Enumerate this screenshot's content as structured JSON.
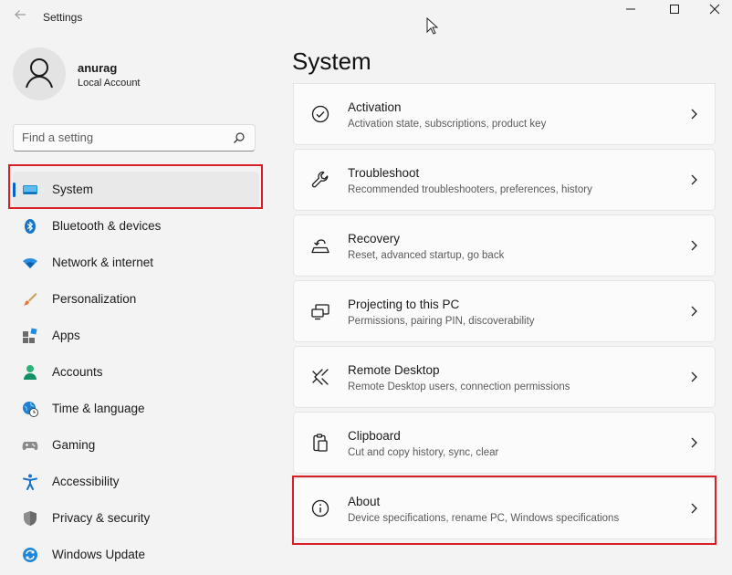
{
  "window": {
    "title": "Settings"
  },
  "user": {
    "name": "anurag",
    "account_type": "Local Account"
  },
  "search": {
    "placeholder": "Find a setting",
    "value": ""
  },
  "sidebar": {
    "items": [
      {
        "label": "System",
        "icon": "monitor-icon",
        "selected": true
      },
      {
        "label": "Bluetooth & devices",
        "icon": "bluetooth-icon"
      },
      {
        "label": "Network & internet",
        "icon": "wifi-icon"
      },
      {
        "label": "Personalization",
        "icon": "brush-icon"
      },
      {
        "label": "Apps",
        "icon": "apps-icon"
      },
      {
        "label": "Accounts",
        "icon": "person-icon"
      },
      {
        "label": "Time & language",
        "icon": "globe-clock-icon"
      },
      {
        "label": "Gaming",
        "icon": "gamepad-icon"
      },
      {
        "label": "Accessibility",
        "icon": "accessibility-icon"
      },
      {
        "label": "Privacy & security",
        "icon": "shield-icon"
      },
      {
        "label": "Windows Update",
        "icon": "update-icon"
      }
    ]
  },
  "main": {
    "title": "System",
    "cards": [
      {
        "title": "Activation",
        "description": "Activation state, subscriptions, product key",
        "icon": "check-circle-icon"
      },
      {
        "title": "Troubleshoot",
        "description": "Recommended troubleshooters, preferences, history",
        "icon": "wrench-icon"
      },
      {
        "title": "Recovery",
        "description": "Reset, advanced startup, go back",
        "icon": "recovery-icon"
      },
      {
        "title": "Projecting to this PC",
        "description": "Permissions, pairing PIN, discoverability",
        "icon": "projecting-icon"
      },
      {
        "title": "Remote Desktop",
        "description": "Remote Desktop users, connection permissions",
        "icon": "remote-desktop-icon"
      },
      {
        "title": "Clipboard",
        "description": "Cut and copy history, sync, clear",
        "icon": "clipboard-icon"
      },
      {
        "title": "About",
        "description": "Device specifications, rename PC, Windows specifications",
        "icon": "info-icon"
      }
    ]
  },
  "colors": {
    "accent": "#0067c0",
    "highlight": "#d81f26",
    "background": "#f3f3f3",
    "card": "#fbfbfb"
  }
}
